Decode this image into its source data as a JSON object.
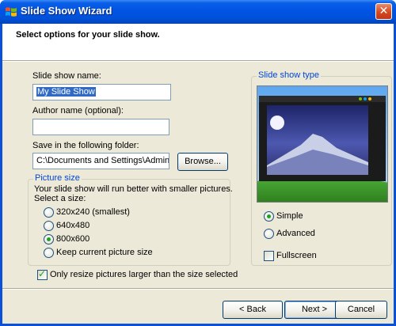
{
  "window": {
    "title": "Slide Show Wizard",
    "close_glyph": "✕"
  },
  "header": {
    "text": "Select options for your slide show."
  },
  "form": {
    "name_label": "Slide show name:",
    "name_value": "My Slide Show",
    "author_label": "Author name (optional):",
    "author_value": "",
    "folder_label": "Save in the following folder:",
    "folder_value": "C:\\Documents and Settings\\Administrat",
    "browse_label": "Browse..."
  },
  "picture_size": {
    "title": "Picture size",
    "desc1": "Your slide show will run better with smaller pictures.",
    "desc2": "Select a size:",
    "options": [
      "320x240 (smallest)",
      "640x480",
      "800x600",
      "Keep current picture size"
    ],
    "selected": "800x600"
  },
  "resize_checkbox": {
    "label": "Only resize pictures larger than the size selected",
    "checked": true
  },
  "slide_show_type": {
    "title": "Slide show type",
    "options": [
      "Simple",
      "Advanced"
    ],
    "selected": "Simple",
    "fullscreen_label": "Fullscreen",
    "fullscreen_checked": false
  },
  "buttons": {
    "back": "< Back",
    "next": "Next >",
    "cancel": "Cancel"
  },
  "icons": {
    "title_icon": "windows-flag-icon",
    "close_icon": "close-icon",
    "check_mark": "✓"
  },
  "colors": {
    "titlebar": "#0054e3",
    "dialog_bg": "#ece9d8",
    "group_title": "#0046d5",
    "selection": "#316ac5"
  }
}
